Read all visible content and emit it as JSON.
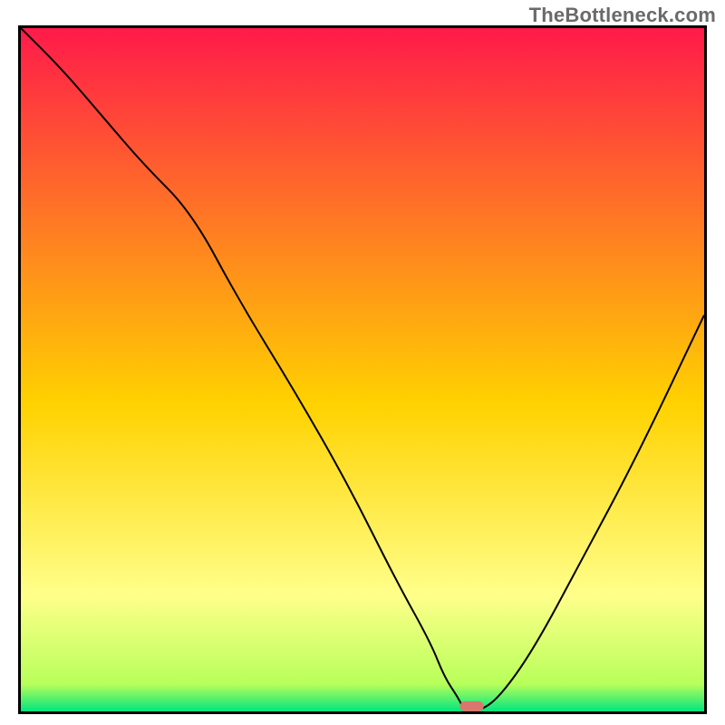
{
  "watermark": {
    "text": "TheBottleneck.com"
  },
  "colors": {
    "gradient_top": "#ff1a4a",
    "gradient_mid": "#ffd200",
    "gradient_glow": "#ffff8a",
    "gradient_bottom": "#00e57e",
    "curve": "#000000",
    "pill": "#d9766f",
    "border": "#000000"
  },
  "chart_data": {
    "type": "line",
    "title": "",
    "xlabel": "",
    "ylabel": "",
    "xlim": [
      0,
      100
    ],
    "ylim": [
      0,
      100
    ],
    "grid": false,
    "legend": false,
    "series": [
      {
        "name": "bottleneck-curve",
        "x": [
          0,
          6,
          12,
          18,
          25,
          32,
          40,
          48,
          55,
          60,
          62,
          64,
          65,
          67,
          70,
          75,
          82,
          90,
          100
        ],
        "y": [
          100,
          94,
          87,
          80,
          73,
          60,
          47,
          33,
          19,
          10,
          5,
          2,
          0,
          0,
          2,
          9,
          22,
          37,
          58
        ]
      }
    ],
    "marker": {
      "name": "optimal-zone",
      "x_center": 66,
      "y_center": 0,
      "width": 3.5,
      "height": 1.5
    },
    "background": {
      "type": "vertical-gradient",
      "stops": [
        {
          "pos": 0.0,
          "color": "#ff1a4a"
        },
        {
          "pos": 0.55,
          "color": "#ffd200"
        },
        {
          "pos": 0.83,
          "color": "#ffff8a"
        },
        {
          "pos": 0.96,
          "color": "#b8ff5a"
        },
        {
          "pos": 1.0,
          "color": "#00e57e"
        }
      ]
    }
  }
}
